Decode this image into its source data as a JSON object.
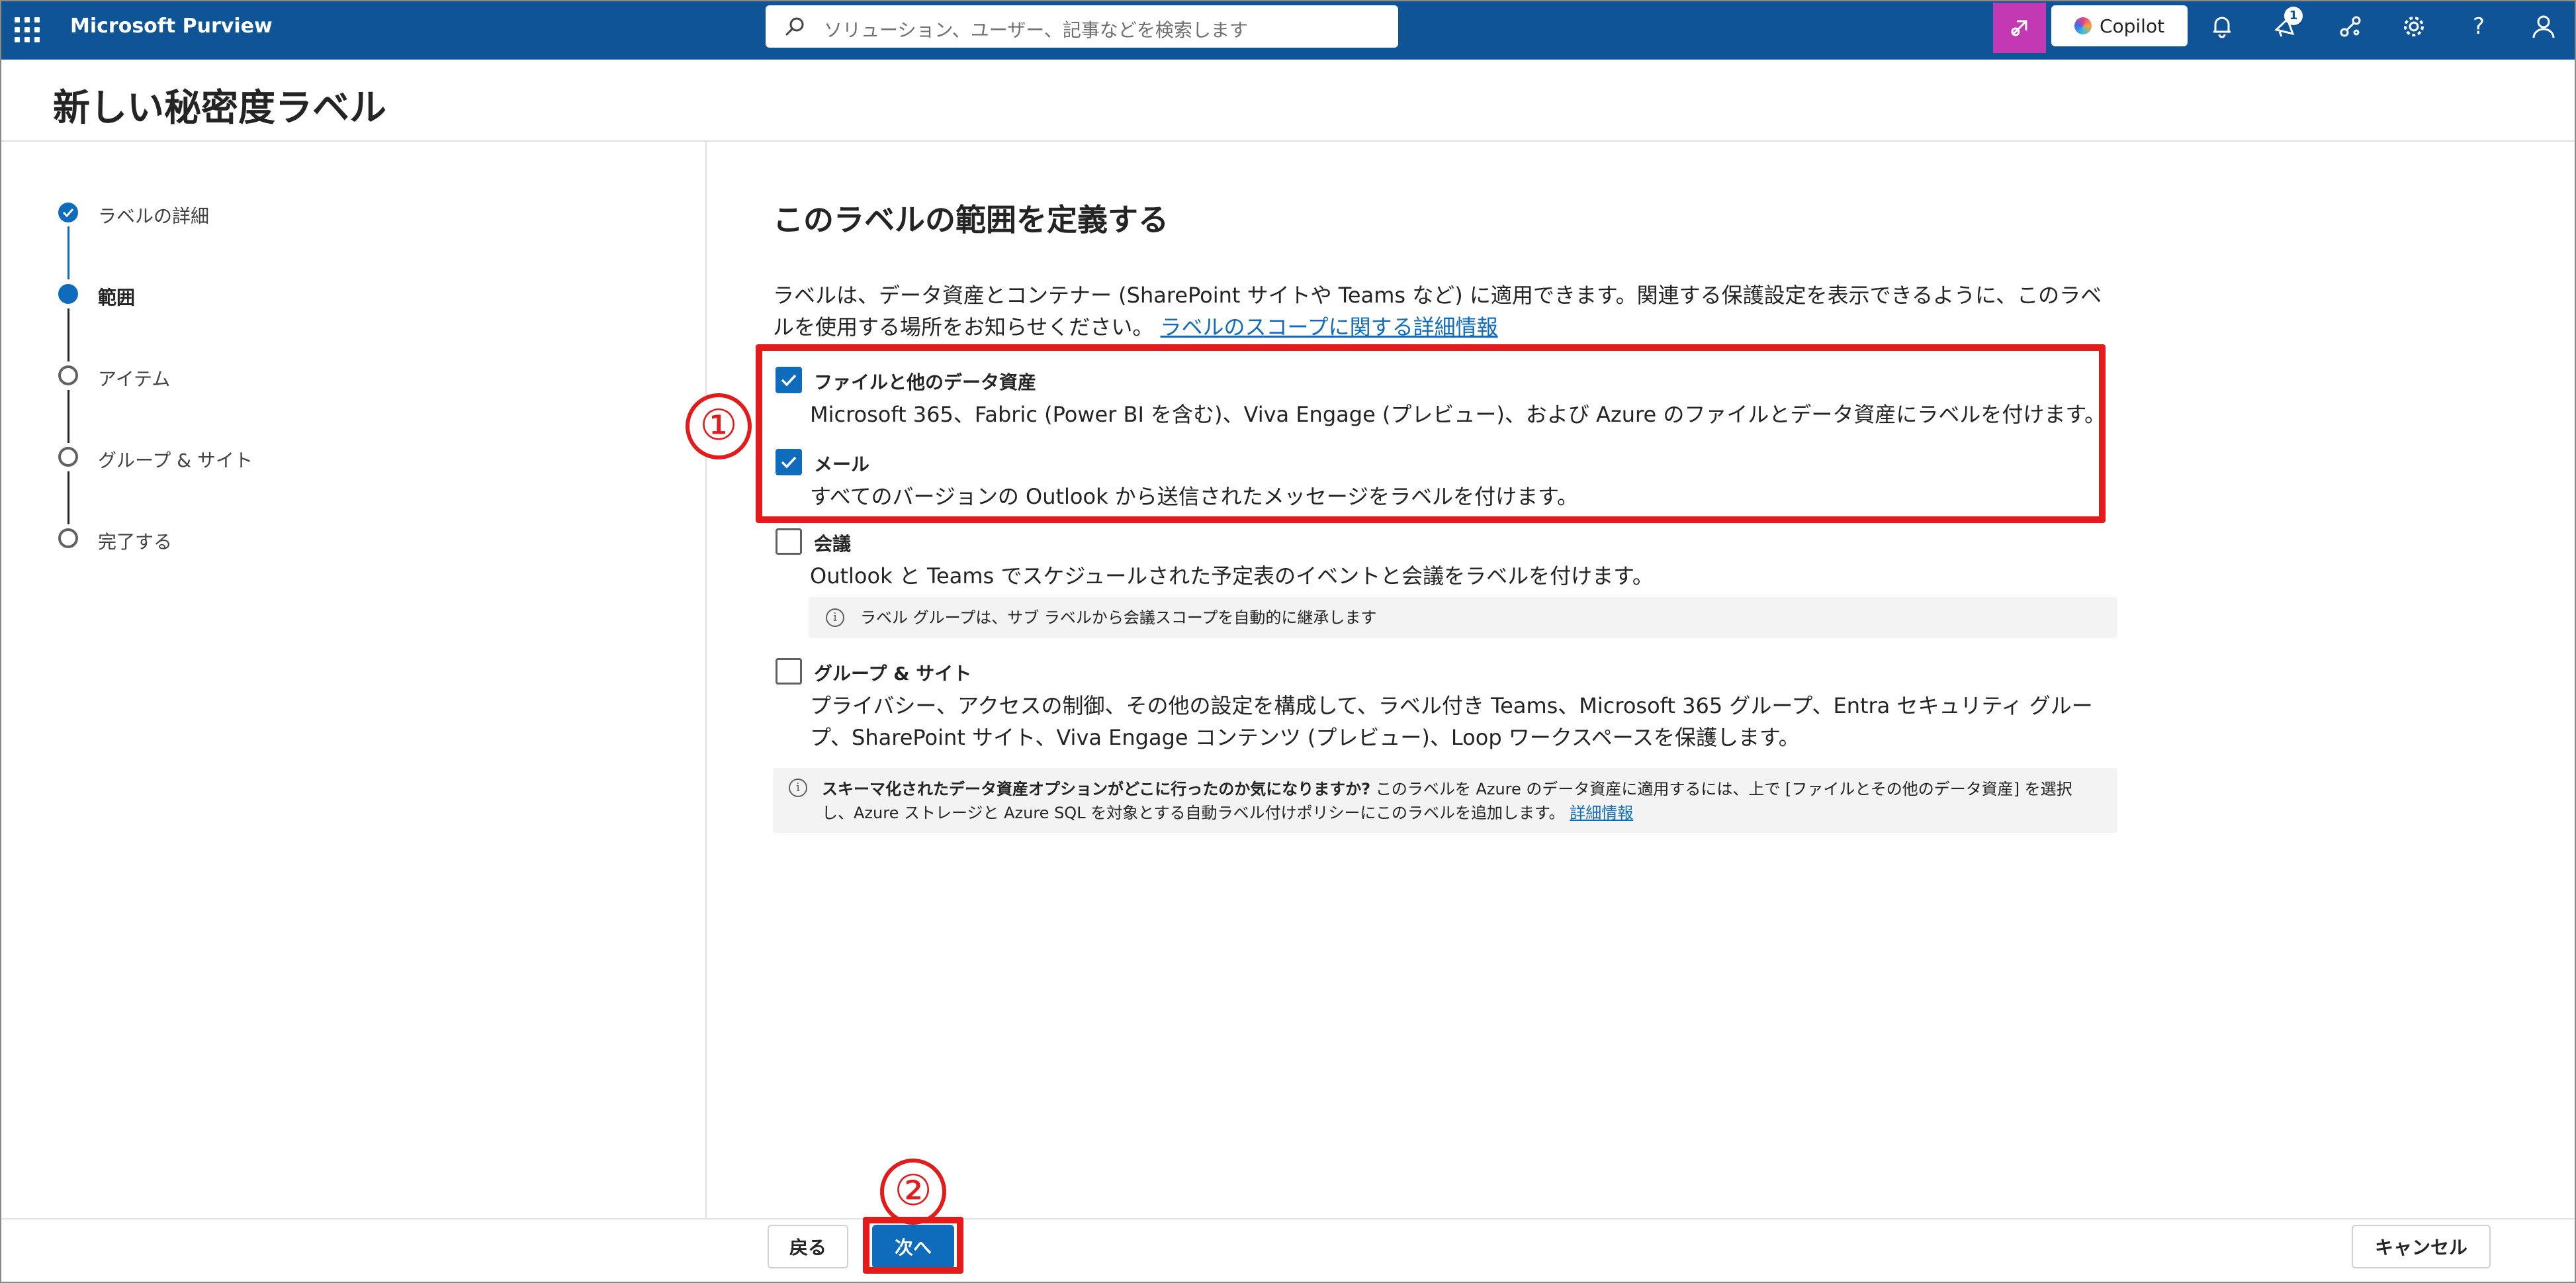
{
  "app": {
    "title": "Microsoft Purview"
  },
  "search": {
    "placeholder": "ソリューション、ユーザー、記事などを検索します"
  },
  "topbar": {
    "copilot_label": "Copilot",
    "notification_badge": "1",
    "icons": [
      "app-launcher-icon",
      "copilot-pink-icon",
      "bell-icon",
      "megaphone-icon",
      "share-icon",
      "gear-icon",
      "help-icon",
      "person-icon"
    ]
  },
  "page": {
    "title": "新しい秘密度ラベル"
  },
  "steps": [
    {
      "label": "ラベルの詳細",
      "state": "done"
    },
    {
      "label": "範囲",
      "state": "current"
    },
    {
      "label": "アイテム",
      "state": "todo"
    },
    {
      "label": "グループ & サイト",
      "state": "todo"
    },
    {
      "label": "完了する",
      "state": "todo"
    }
  ],
  "main": {
    "heading": "このラベルの範囲を定義する",
    "description_line1": "ラベルは、データ資産とコンテナー (SharePoint サイトや Teams など) に適用できます。関連する保護設定を表示できるように、このラベ",
    "description_line2": "ルを使用する場所をお知らせください。",
    "description_link": "ラベルのスコープに関する詳細情報",
    "options": [
      {
        "title": "ファイルと他のデータ資産",
        "checked": true,
        "desc_lines": [
          "Microsoft 365、Fabric (Power BI を含む)、Viva Engage (プレビュー)、および Azure のファイルとデータ資産にラベルを付けます。"
        ]
      },
      {
        "title": "メール",
        "checked": true,
        "desc_lines": [
          "すべてのバージョンの Outlook から送信されたメッセージをラベルを付けます。"
        ]
      },
      {
        "title": "会議",
        "checked": false,
        "desc_lines": [
          "Outlook と Teams でスケジュールされた予定表のイベントと会議をラベルを付けます。"
        ]
      },
      {
        "title": "グループ & サイト",
        "checked": false,
        "desc_lines": [
          "プライバシー、アクセスの制御、その他の設定を構成して、ラベル付き Teams、Microsoft 365 グループ、Entra セキュリティ グルー",
          "プ、SharePoint サイト、Viva Engage コンテンツ (プレビュー)、Loop ワークスペースを保護します。"
        ]
      }
    ],
    "meeting_info": "ラベル グループは、サブ ラベルから会議スコープを自動的に継承します",
    "schema_info": {
      "bold": "スキーマ化されたデータ資産オプションがどこに行ったのか気になりますか?",
      "text1": " このラベルを Azure のデータ資産に適用するには、上で [ファイルとその他のデータ資産] を選択",
      "text2": "し、Azure ストレージと Azure SQL を対象とする自動ラベル付けポリシーにこのラベルを追加します。",
      "link": "詳細情報"
    }
  },
  "annotations": {
    "marker1": "①",
    "marker2": "②",
    "color": "#e31b1b"
  },
  "footer": {
    "back": "戻る",
    "next": "次へ",
    "cancel": "キャンセル"
  },
  "colors": {
    "topbar": "#0f5496",
    "accent": "#0f6cbd",
    "copilot_button": "#c239b3"
  }
}
